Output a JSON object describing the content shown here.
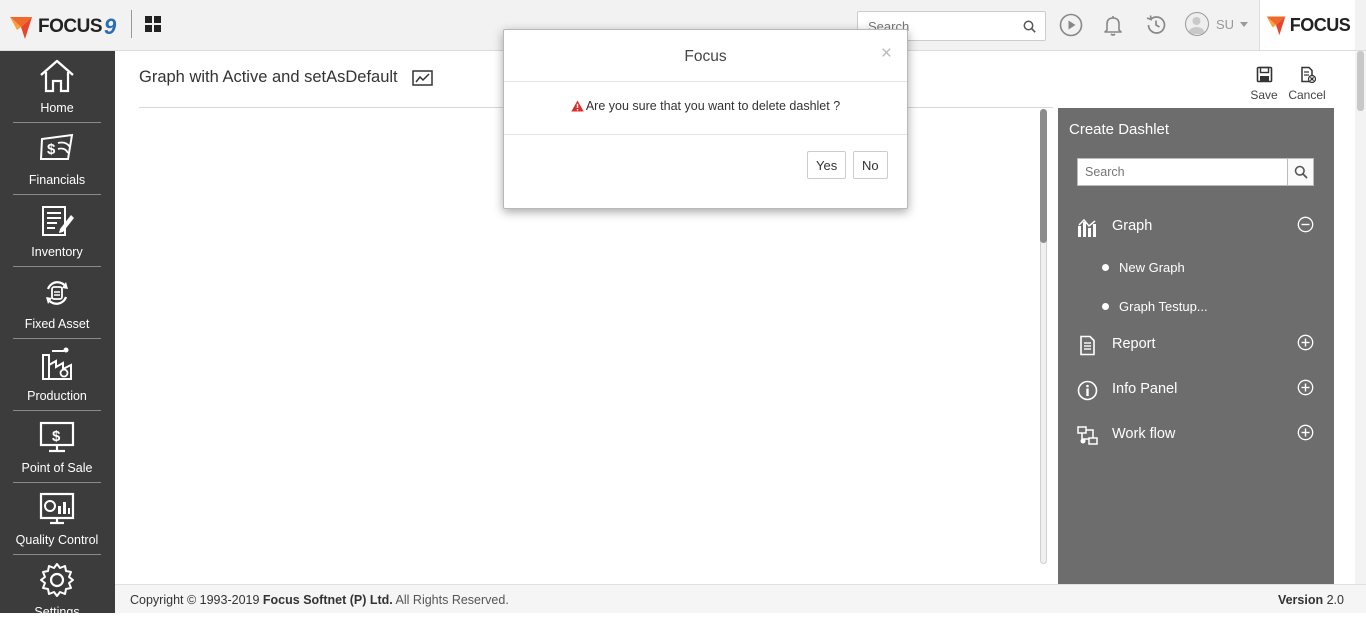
{
  "topbar": {
    "logo_text": "FOCUS",
    "logo_number": "9",
    "search_placeholder": "Search",
    "user_initials": "SU",
    "brand_right_text": "FOCUS"
  },
  "sidebar": {
    "items": [
      {
        "label": "Home",
        "icon": "home-icon"
      },
      {
        "label": "Financials",
        "icon": "financials-icon"
      },
      {
        "label": "Inventory",
        "icon": "inventory-icon"
      },
      {
        "label": "Fixed Asset",
        "icon": "fixed-asset-icon"
      },
      {
        "label": "Production",
        "icon": "production-icon"
      },
      {
        "label": "Point of Sale",
        "icon": "point-of-sale-icon"
      },
      {
        "label": "Quality Control",
        "icon": "quality-control-icon"
      },
      {
        "label": "Settings",
        "icon": "settings-icon"
      }
    ]
  },
  "main": {
    "title": "Graph with Active and setAsDefault",
    "save_label": "Save",
    "cancel_label": "Cancel"
  },
  "panel": {
    "title": "Create Dashlet",
    "search_placeholder": "Search",
    "categories": [
      {
        "label": "Graph",
        "icon": "graph-icon",
        "expanded": true,
        "items": [
          "New Graph",
          "Graph Testup..."
        ]
      },
      {
        "label": "Report",
        "icon": "report-icon",
        "expanded": false
      },
      {
        "label": "Info Panel",
        "icon": "info-panel-icon",
        "expanded": false
      },
      {
        "label": "Work flow",
        "icon": "work-flow-icon",
        "expanded": false
      }
    ]
  },
  "footer": {
    "copyright_prefix": "Copyright © 1993-2019 ",
    "company": "Focus Softnet (P) Ltd.",
    "rights": " All Rights Reserved.",
    "version_label": "Version",
    "version_number": "2.0"
  },
  "modal": {
    "title": "Focus",
    "close": "×",
    "message": "Are you sure that you want to delete dashlet ?",
    "yes_label": "Yes",
    "no_label": "No"
  },
  "colors": {
    "sidebar_bg": "#3c3c3c",
    "panel_bg": "#6d6d6d",
    "warning": "#d9302c",
    "logo_blue": "#2a6fb5",
    "logo_orange": "#f0692a"
  }
}
